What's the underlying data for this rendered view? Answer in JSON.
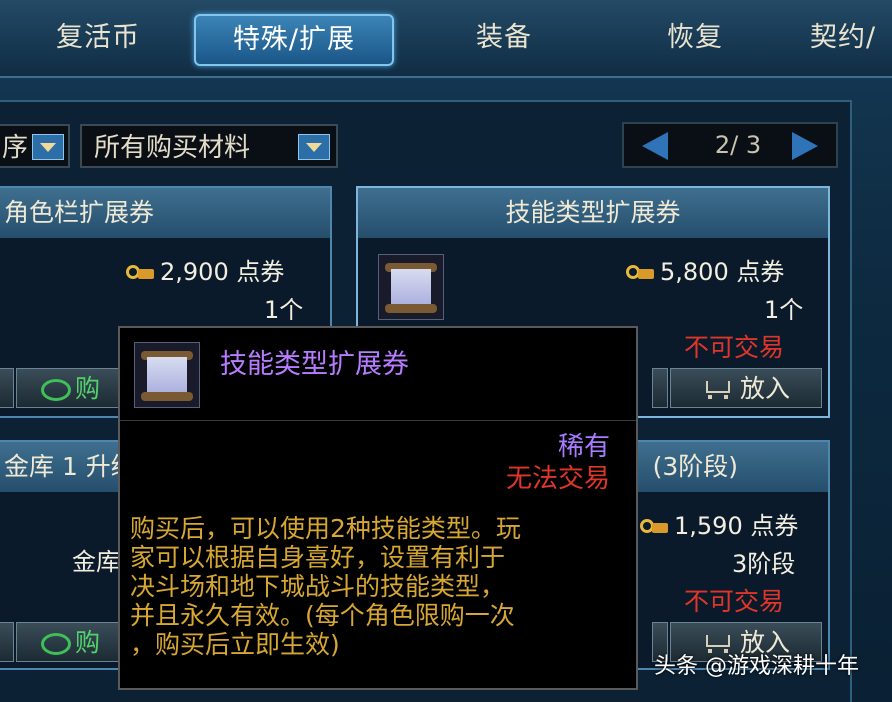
{
  "tabs": [
    {
      "label": "复活币"
    },
    {
      "label": "特殊/扩展"
    },
    {
      "label": "装备"
    },
    {
      "label": "恢复"
    },
    {
      "label": "契约/"
    }
  ],
  "filters": {
    "sort_label": "序",
    "material_label": "所有购买材料"
  },
  "pager": {
    "text": "2/ 3"
  },
  "cards": {
    "char_slot": {
      "title": "角色栏扩展券",
      "price": "2,900 点券",
      "qty": "1个",
      "buy": "购"
    },
    "skill_type": {
      "title": "技能类型扩展券",
      "price": "5,800 点券",
      "qty": "1个",
      "trade": "不可交易",
      "put_in": "放入"
    },
    "storage": {
      "title": "金库 1 升级",
      "partial": "金库",
      "buy": "购"
    },
    "stage3": {
      "title": "(3阶段)",
      "price": "1,590 点券",
      "qty": "3阶段",
      "trade": "不可交易",
      "put_in": "放入"
    }
  },
  "tooltip": {
    "name": "技能类型扩展券",
    "rarity": "稀有",
    "tradeability": "无法交易",
    "description": [
      "购买后，可以使用2种技能类型。玩",
      "家可以根据自身喜好，设置有利于",
      "决斗场和地下城战斗的技能类型，",
      "并且永久有效。(每个角色限购一次",
      "，购买后立即生效)"
    ]
  },
  "watermark": "头条 @游戏深耕十年"
}
